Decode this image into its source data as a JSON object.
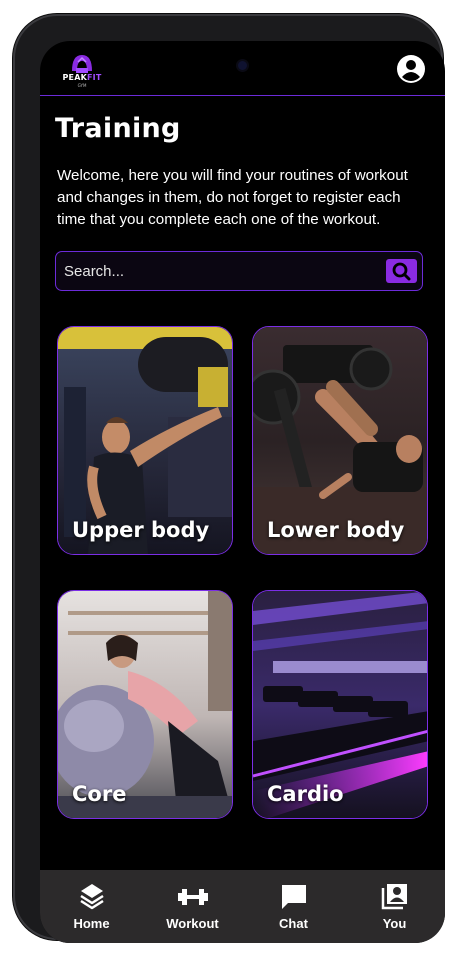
{
  "brand": {
    "name_part1": "PEAK",
    "name_part2": "FIT",
    "sub": "GYM",
    "accent": "#8a2be2"
  },
  "header": {
    "profile_icon": "account-circle-icon"
  },
  "page": {
    "title": "Training",
    "intro": "Welcome, here you will find your routines of workout and changes in them, do not forget to register each time that you complete each one of the workout."
  },
  "search": {
    "placeholder": "Search...",
    "value": "",
    "icon": "search-icon"
  },
  "categories": [
    {
      "label": "Upper body"
    },
    {
      "label": "Lower body"
    },
    {
      "label": "Core"
    },
    {
      "label": "Cardio"
    }
  ],
  "nav": [
    {
      "label": "Home",
      "icon": "layers-icon"
    },
    {
      "label": "Workout",
      "icon": "dumbbell-icon"
    },
    {
      "label": "Chat",
      "icon": "chat-icon"
    },
    {
      "label": "You",
      "icon": "contacts-icon"
    }
  ]
}
